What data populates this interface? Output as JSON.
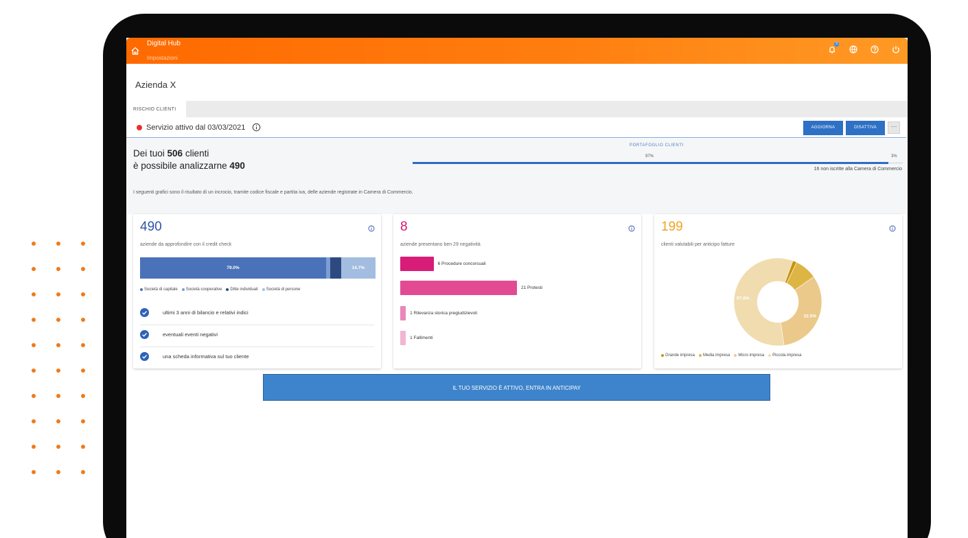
{
  "header": {
    "app_title": "Digital Hub",
    "subtitle": "Impostazioni",
    "notification_count": "3"
  },
  "company": {
    "name": "Azienda X"
  },
  "tabs": [
    {
      "label": "RISCHIO CLIENTI"
    }
  ],
  "status": {
    "text": "Servizio attivo dal 03/03/2021",
    "indicator_color": "#e8302a",
    "update_label": "AGGIORNA",
    "disable_label": "DISATTIVA",
    "more_label": "···"
  },
  "summary": {
    "line1_prefix": "Dei tuoi ",
    "total_clients": "506",
    "line1_suffix": " clienti",
    "line2_prefix": "è possibile analizzarne ",
    "analyzable": "490",
    "portfolio_label": "PORTAFOGLIO CLIENTI",
    "portfolio_pct_registered": "97%",
    "portfolio_pct_unregistered": "3%",
    "portfolio_fill": 0.97,
    "not_registered_text": "16 non iscritte alla Camera di Commercio",
    "description": "I seguenti grafici sono il risultato di un incrocio, tramite codice fiscale e partita iva, delle aziende registrate in Camera di Commercio."
  },
  "card1": {
    "value": "490",
    "subtitle": "aziende da approfondire con il credit check",
    "value_color": "#2e55a8",
    "chart_data": {
      "type": "bar",
      "stacked": true,
      "orientation": "horizontal",
      "series": [
        {
          "name": "Società di capitale",
          "value": 79.0,
          "color": "#4a72b8"
        },
        {
          "name": "Società cooperative",
          "value": 1.7,
          "color": "#7c9ed4"
        },
        {
          "name": "Ditte individuali",
          "value": 4.6,
          "color": "#2d4a80"
        },
        {
          "name": "Società di persone",
          "value": 14.7,
          "color": "#a3bde0"
        }
      ],
      "data_labels": [
        "79.0%",
        "14.7%"
      ]
    },
    "features": [
      "ultimi 3 anni di bilancio e relativi indici",
      "eventuali eventi negativi",
      "una scheda informativa sul tuo cliente"
    ]
  },
  "card2": {
    "value": "8",
    "subtitle": "aziende presentano ben 29 negatività",
    "value_color": "#d6136f",
    "chart_data": {
      "type": "bar",
      "orientation": "horizontal",
      "categories": [
        "6 Procedure concorsuali",
        "21 Protesti",
        "1 Rilevanza storica pregiudizievoli",
        "1 Fallimenti"
      ],
      "values": [
        6,
        21,
        1,
        1
      ],
      "colors": [
        "#d81d78",
        "#e24b93",
        "#eb86b8",
        "#f2b5d2"
      ]
    }
  },
  "card3": {
    "value": "199",
    "subtitle": "clienti valutabili per anticipo fatture",
    "value_color": "#f0a321",
    "chart_data": {
      "type": "pie",
      "donut": true,
      "series": [
        {
          "name": "Grande impresa",
          "value": 1.5,
          "color": "#c7940e"
        },
        {
          "name": "Media impresa",
          "value": 8.2,
          "color": "#ddb544"
        },
        {
          "name": "Micro impresa",
          "value": 32.5,
          "color": "#ebc98a"
        },
        {
          "name": "Piccola impresa",
          "value": 57.8,
          "color": "#f0dcaf"
        }
      ],
      "data_labels": [
        "57.8%",
        "32.5%"
      ]
    }
  },
  "cta": {
    "label": "IL TUO SERVIZIO È ATTIVO, ENTRA IN ANTICIPAY"
  }
}
